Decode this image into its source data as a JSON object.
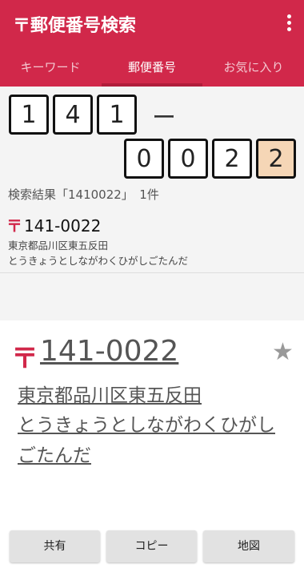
{
  "app": {
    "title": "〒郵便番号検索",
    "menu_icon": "more-vert-icon"
  },
  "tabs": [
    {
      "label": "キーワード"
    },
    {
      "label": "郵便番号"
    },
    {
      "label": "お気に入り"
    }
  ],
  "input": {
    "digits": [
      "1",
      "4",
      "1",
      "0",
      "0",
      "2",
      "2"
    ],
    "separator": "ー"
  },
  "results": {
    "label": "検索結果「1410022」　1件",
    "items": [
      {
        "mark": "〒",
        "code": "141-0022",
        "address": "東京都品川区東五反田",
        "kana": "とうきょうとしながわくひがしごたんだ"
      }
    ]
  },
  "detail": {
    "mark": "〒",
    "code": "141-0022",
    "address": "東京都品川区東五反田",
    "kana": "とうきょうとしながわくひがしごたんだ",
    "star_icon": "star-icon",
    "star_glyph": "★"
  },
  "buttons": {
    "share": "共有",
    "copy": "コピー",
    "map": "地図"
  },
  "colors": {
    "accent": "#d1284a",
    "current_digit": "#f5d6b6"
  }
}
